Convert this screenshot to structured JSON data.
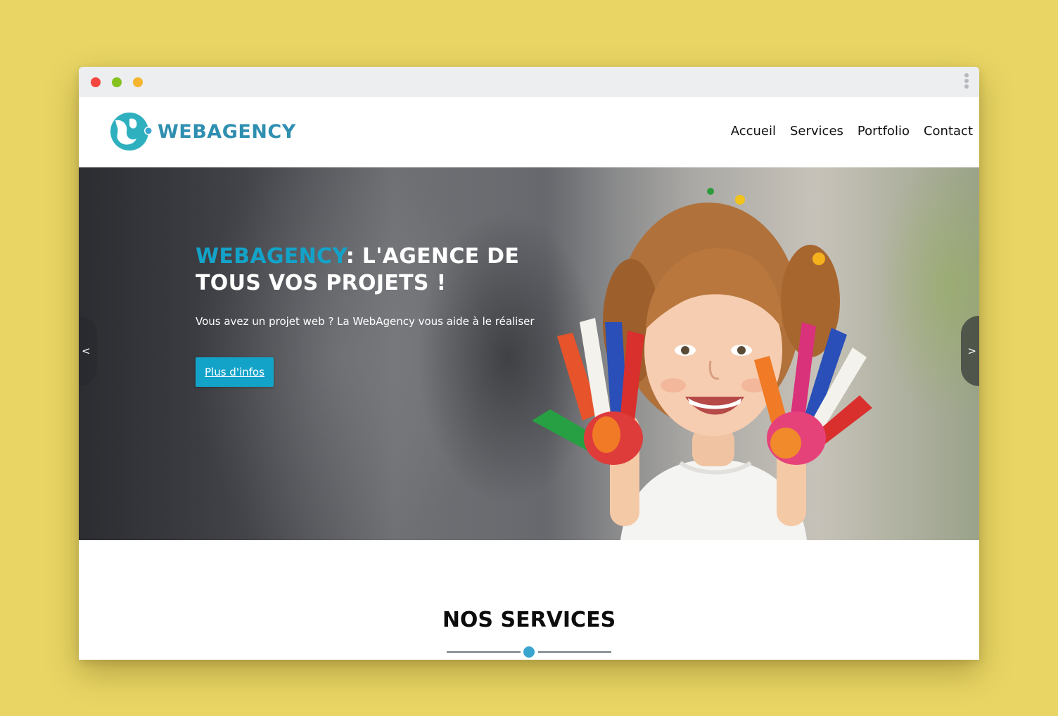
{
  "browser": {
    "controls": [
      "close",
      "minimize",
      "maximize"
    ],
    "menu_icon": "kebab-menu-icon"
  },
  "header": {
    "logo_text": "WEBAGENCY",
    "nav": [
      {
        "label": "Accueil"
      },
      {
        "label": "Services"
      },
      {
        "label": "Portfolio"
      },
      {
        "label": "Contact"
      }
    ]
  },
  "hero": {
    "title_brand": "WEBAGENCY",
    "title_rest": ": L'AGENCE DE TOUS VOS PROJETS !",
    "subtitle": "Vous avez un projet web ? La WebAgency vous aide à le réaliser",
    "button_label": "Plus d'infos",
    "prev_label": "<",
    "next_label": ">"
  },
  "services": {
    "title": "NOS SERVICES"
  },
  "colors": {
    "background": "#e8d564",
    "accent": "#13a3c9",
    "logo": "#2f8fb0",
    "divider_dot": "#3aa6d0"
  }
}
